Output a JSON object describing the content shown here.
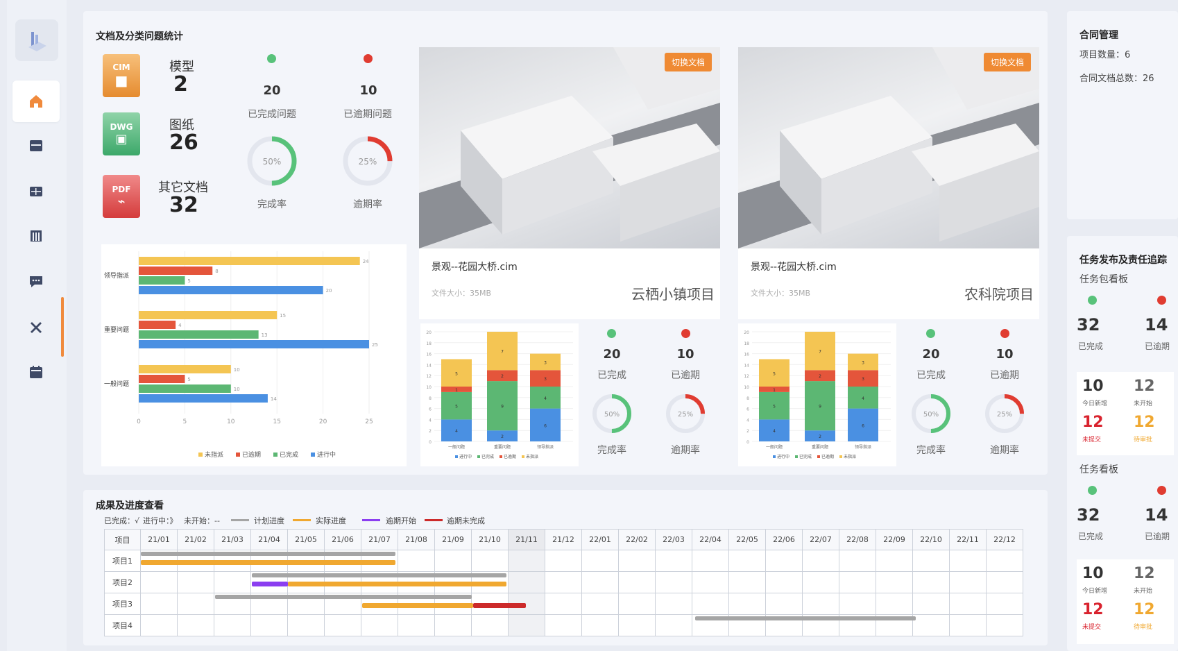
{
  "nav": {
    "items": [
      "home-icon",
      "store-icon",
      "table-icon",
      "building-icon",
      "message-icon",
      "tools-icon",
      "calendar-icon"
    ],
    "active": "home-icon"
  },
  "colors": {
    "accent": "#f08a3c",
    "green": "#58c27a",
    "red": "#e03c31",
    "yellow": "#f4c553",
    "blue": "#4a90e2",
    "gantt_plan": "#a5a5a5",
    "gantt_actual": "#f0a830",
    "gantt_overdue_start": "#8b3ef0",
    "gantt_overdue_unfinished": "#cc2a2a"
  },
  "doc_stats": {
    "title": "文档及分类问题统计",
    "docs": [
      {
        "icon_text": "CIM",
        "label": "模型",
        "value": "2"
      },
      {
        "icon_text": "DWG",
        "label": "图纸",
        "value": "26"
      },
      {
        "icon_text": "PDF",
        "label": "其它文档",
        "value": "32"
      }
    ],
    "done": {
      "value": "20",
      "label": "已完成问题",
      "rate": "50%",
      "rate_label": "完成率",
      "fraction": 0.5
    },
    "overdue": {
      "value": "10",
      "label": "已逾期问题",
      "rate": "25%",
      "rate_label": "逾期率",
      "fraction": 0.25
    }
  },
  "chart_data": [
    {
      "type": "bar",
      "orientation": "horizontal",
      "categories": [
        "领导指派",
        "重要问题",
        "一般问题"
      ],
      "series": [
        {
          "name": "未指派",
          "color": "#f4c553",
          "values": [
            24,
            15,
            10
          ]
        },
        {
          "name": "已逾期",
          "color": "#e4553b",
          "values": [
            8,
            4,
            5
          ]
        },
        {
          "name": "已完成",
          "color": "#5cb773",
          "values": [
            5,
            13,
            10
          ]
        },
        {
          "name": "进行中",
          "color": "#4a90e2",
          "values": [
            20,
            25,
            14
          ]
        }
      ],
      "xlim": [
        0,
        25
      ],
      "xticks": [
        "0",
        "5",
        "10",
        "15",
        "20",
        "25"
      ]
    },
    {
      "type": "bar",
      "stacked": true,
      "categories": [
        "一般问题",
        "重要问题",
        "领导指派"
      ],
      "series": [
        {
          "name": "进行中",
          "color": "#4a90e2",
          "values": [
            4,
            2,
            6
          ]
        },
        {
          "name": "已完成",
          "color": "#5cb773",
          "values": [
            5,
            9,
            4
          ]
        },
        {
          "name": "已逾期",
          "color": "#e4553b",
          "values": [
            1,
            2,
            3
          ]
        },
        {
          "name": "未指派",
          "color": "#f4c553",
          "values": [
            5,
            7,
            3
          ]
        }
      ],
      "ylim": [
        0,
        20
      ]
    },
    {
      "type": "bar",
      "stacked": true,
      "categories": [
        "一般问题",
        "重要问题",
        "领导指派"
      ],
      "series": [
        {
          "name": "进行中",
          "color": "#4a90e2",
          "values": [
            4,
            2,
            6
          ]
        },
        {
          "name": "已完成",
          "color": "#5cb773",
          "values": [
            5,
            9,
            4
          ]
        },
        {
          "name": "已逾期",
          "color": "#e4553b",
          "values": [
            1,
            2,
            3
          ]
        },
        {
          "name": "未指派",
          "color": "#f4c553",
          "values": [
            5,
            7,
            3
          ]
        }
      ],
      "ylim": [
        0,
        20
      ]
    }
  ],
  "projects": [
    {
      "badge": "切换文档",
      "file": "景观--花园大桥.cim",
      "size": "文件大小：35MB",
      "name": "云栖小镇项目",
      "done": "20",
      "done_label": "已完成",
      "overdue": "10",
      "overdue_label": "已逾期",
      "rate_done": "50%",
      "rate_done_label": "完成率",
      "rate_over": "25%",
      "rate_over_label": "逾期率"
    },
    {
      "badge": "切换文档",
      "file": "景观--花园大桥.cim",
      "size": "文件大小：35MB",
      "name": "农科院项目",
      "done": "20",
      "done_label": "已完成",
      "overdue": "10",
      "overdue_label": "已逾期",
      "rate_done": "50%",
      "rate_done_label": "完成率",
      "rate_over": "25%",
      "rate_over_label": "逾期率"
    }
  ],
  "contract": {
    "title": "合同管理",
    "project_count": "项目数量：6",
    "doc_total": "合同文档总数：26"
  },
  "tasks": {
    "title": "任务发布及责任追踪",
    "boards": [
      {
        "name": "任务包看板",
        "done": "32",
        "done_label": "已完成",
        "overdue": "14",
        "overdue_label": "已逾期",
        "today_new": "10",
        "today_new_label": "今日新增",
        "unassigned": "12",
        "unassigned_label": "未开始",
        "not_submitted": "12",
        "not_submitted_label": "未提交",
        "pending": "12",
        "pending_label": "待审批"
      },
      {
        "name": "任务看板",
        "done": "32",
        "done_label": "已完成",
        "overdue": "14",
        "overdue_label": "已逾期",
        "today_new": "10",
        "today_new_label": "今日新增",
        "unassigned": "12",
        "unassigned_label": "未开始",
        "not_submitted": "12",
        "not_submitted_label": "未提交",
        "pending": "12",
        "pending_label": "待审批"
      }
    ]
  },
  "gantt": {
    "title": "成果及进度查看",
    "legend": {
      "done": "已完成：√",
      "doing": "进行中：》",
      "not_started": "未开始：--",
      "plan": "计划进度",
      "actual": "实际进度",
      "overdue_start": "逾期开始",
      "overdue_unfinished": "逾期未完成"
    },
    "header_label": "项目",
    "months": [
      "21/01",
      "21/02",
      "21/03",
      "21/04",
      "21/05",
      "21/06",
      "21/07",
      "21/08",
      "21/09",
      "21/10",
      "21/11",
      "21/12",
      "22/01",
      "22/02",
      "22/03",
      "22/04",
      "22/05",
      "22/06",
      "22/07",
      "22/08",
      "22/09",
      "22/10",
      "22/11",
      "22/12"
    ],
    "rows": [
      "项目1",
      "项目2",
      "项目3",
      "项目4"
    ]
  }
}
